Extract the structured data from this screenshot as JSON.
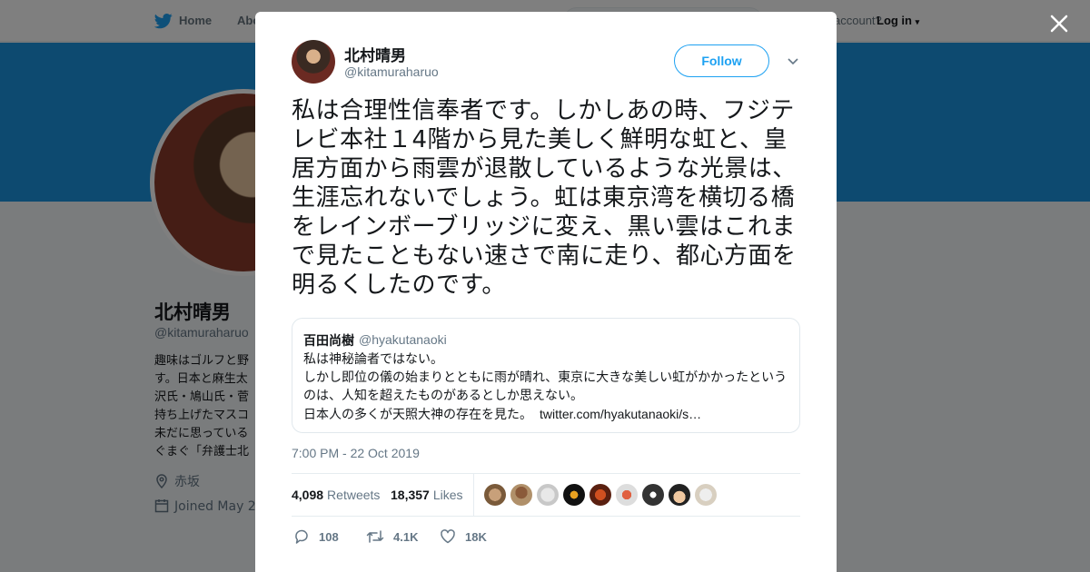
{
  "nav": {
    "home_label": "Home",
    "about_label": "Abo",
    "account_text": "account?",
    "login_label": "Log in"
  },
  "profile_bg": {
    "name": "北村晴男",
    "handle": "@kitamuraharuo",
    "bio": "趣味はゴルフと野\nす。日本と麻生太\n沢氏・鳩山氏・菅\n持ち上げたマスコ\n未だに思っている\nぐまぐ「弁護士北",
    "location": "赤坂",
    "joined": "Joined May 20"
  },
  "tweet": {
    "author_name": "北村晴男",
    "author_handle": "@kitamuraharuo",
    "follow_label": "Follow",
    "text": "私は合理性信奉者です。しかしあの時、フジテレビ本社１4階から見た美しく鮮明な虹と、皇居方面から雨雲が退散しているような光景は、生涯忘れないでしょう。虹は東京湾を横切る橋をレインボーブリッジに変え、黒い雲はこれまで見たこともない速さで南に走り、都心方面を明るくしたのです。",
    "quote": {
      "name": "百田尚樹",
      "handle": "@hyakutanaoki",
      "line1": "私は神秘論者ではない。",
      "line2": "しかし即位の儀の始まりとともに雨が晴れ、東京に大きな美しい虹がかかったという",
      "line3": "のは、人知を超えたものがあるとしか思えない。",
      "line4": "日本人の多くが天照大神の存在を見た。",
      "link": "twitter.com/hyakutanaoki/s…"
    },
    "timestamp": "7:00 PM - 22 Oct 2019",
    "retweets_count": "4,098",
    "retweets_label": "Retweets",
    "likes_count": "18,357",
    "likes_label": "Likes",
    "actions": {
      "reply_count": "108",
      "retweet_count": "4.1K",
      "like_count": "18K"
    }
  },
  "colors": {
    "brand_blue": "#1da1f2",
    "banner_blue": "#1b95e0",
    "text_primary": "#14171a",
    "text_secondary": "#657786"
  },
  "icons": {
    "nav_logo": "twitter-bird-icon",
    "close": "close-icon",
    "caret": "chevron-down-icon",
    "reply": "reply-icon",
    "retweet": "retweet-icon",
    "like": "heart-icon",
    "location": "location-pin-icon",
    "calendar": "calendar-icon"
  }
}
